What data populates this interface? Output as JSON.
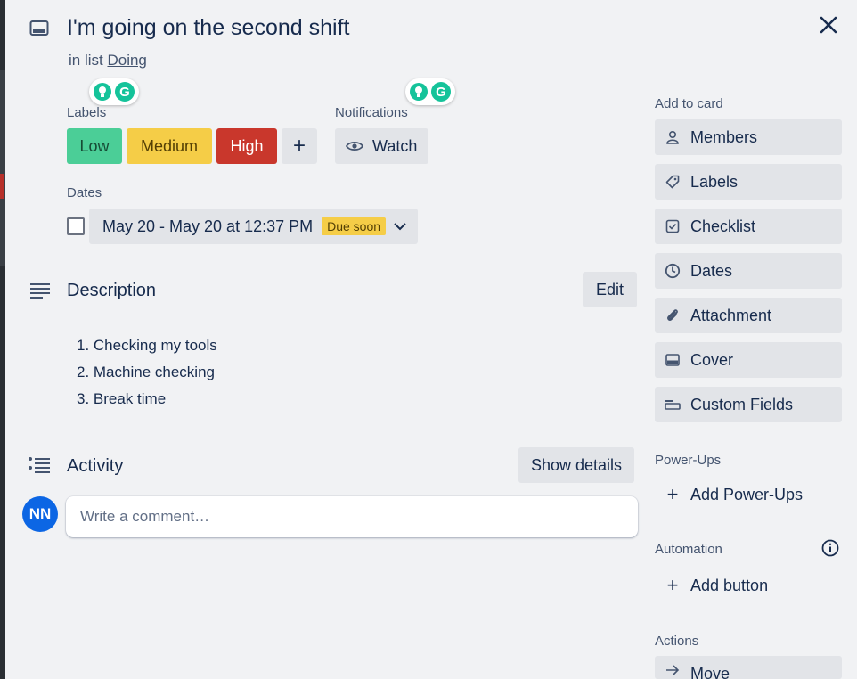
{
  "card": {
    "title": "I'm going on the second shift",
    "list_prefix": "in list",
    "list_name": "Doing"
  },
  "labels": {
    "heading": "Labels",
    "items": [
      {
        "text": "Low",
        "color": "#4bce97"
      },
      {
        "text": "Medium",
        "color": "#f5cd47"
      },
      {
        "text": "High",
        "color": "#c9372c"
      }
    ],
    "add_symbol": "+"
  },
  "notifications": {
    "heading": "Notifications",
    "watch_label": "Watch"
  },
  "dates": {
    "heading": "Dates",
    "range": "May 20 - May 20 at 12:37 PM",
    "badge": "Due soon"
  },
  "description": {
    "heading": "Description",
    "edit_label": "Edit",
    "items": [
      "1. Checking my tools",
      "2. Machine checking",
      "3. Break time"
    ]
  },
  "activity": {
    "heading": "Activity",
    "details_label": "Show details",
    "avatar_initials": "NN",
    "comment_placeholder": "Write a comment…"
  },
  "sidebar": {
    "add_to_card": "Add to card",
    "buttons": [
      {
        "label": "Members",
        "icon": "person-icon"
      },
      {
        "label": "Labels",
        "icon": "tag-icon"
      },
      {
        "label": "Checklist",
        "icon": "checklist-icon"
      },
      {
        "label": "Dates",
        "icon": "clock-icon"
      },
      {
        "label": "Attachment",
        "icon": "paperclip-icon"
      },
      {
        "label": "Cover",
        "icon": "cover-icon"
      },
      {
        "label": "Custom Fields",
        "icon": "custom-fields-icon"
      }
    ],
    "power_ups": "Power-Ups",
    "add_power_ups": "Add Power-Ups",
    "automation": "Automation",
    "add_button": "Add button",
    "actions": "Actions",
    "move": "Move"
  },
  "colors": {
    "accent": "#0c66e4",
    "grammarly": "#15c39a"
  }
}
